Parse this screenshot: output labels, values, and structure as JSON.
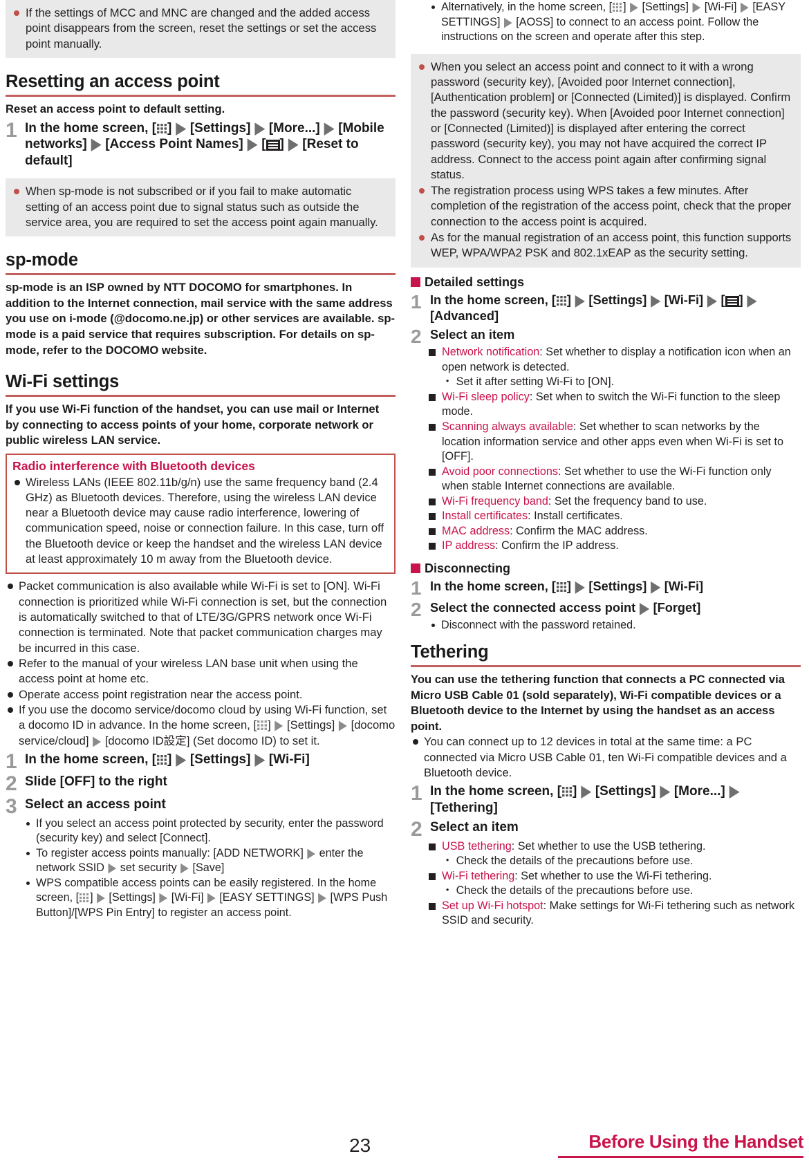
{
  "icons": {
    "app_grid": "app-grid-icon",
    "menu": "menu-icon",
    "arrow": "▶"
  },
  "colors": {
    "rule": "#c2605e",
    "accent": "#c8134b",
    "note_bullet": "#c0504a",
    "step_number": "#9a9a9a"
  },
  "left": {
    "note_top": "If the settings of MCC and MNC are changed and the added access point disappears from the screen, reset the settings or set the access point manually.",
    "sec_reset": "Resetting an access point",
    "reset_lead": "Reset an access point to default setting.",
    "reset_step1_num": "1",
    "reset_step1_a": "In the home screen, [",
    "reset_step1_b": "] ",
    "reset_step1_c": "[Settings] ",
    "reset_step1_d": "[More...] ",
    "reset_step1_e": "[Mobile networks] ",
    "reset_step1_f": "[Access Point Names] ",
    "reset_step1_g": "] ",
    "reset_step1_h": "[Reset to default]",
    "note_spmode": "When sp-mode is not subscribed or if you fail to make automatic setting of an access point due to signal status such as outside the service area, you are required to set the access point again manually.",
    "sec_spmode": "sp-mode",
    "spmode_lead": "sp-mode is an ISP owned by NTT DOCOMO for smartphones. In addition to the Internet connection, mail service with the same address you use on i-mode (@docomo.ne.jp) or other services are available. sp-mode is a paid service that requires subscription. For details on sp-mode, refer to the DOCOMO website.",
    "sec_wifi": "Wi-Fi settings",
    "wifi_lead": "If you use Wi-Fi function of the handset, you can use mail or Internet by connecting to access points of your home, corporate network or public wireless LAN service.",
    "redbox_title": "Radio interference with Bluetooth devices",
    "redbox_body": "Wireless LANs (IEEE 802.11b/g/n) use the same frequency band (2.4 GHz) as Bluetooth devices. Therefore, using the wireless LAN device near a Bluetooth device may cause radio interference, lowering of communication speed, noise or connection failure. In this case, turn off the Bluetooth device or keep the handset and the wireless LAN device at least approximately 10 m away from the Bluetooth device.",
    "bullets": [
      "Packet communication is also available while Wi-Fi is set to [ON]. Wi-Fi connection is prioritized while Wi-Fi connection is set, but the connection is automatically switched to that of LTE/3G/GPRS network once Wi-Fi connection is terminated. Note that packet communication charges may be incurred in this case.",
      "Refer to the manual of your wireless LAN base unit when using the access point at home etc.",
      "Operate access point registration near the access point."
    ],
    "docomo_bullet_1": "If you use the docomo service/docomo cloud by using Wi-Fi function, set a docomo ID in advance. In the home screen, [",
    "docomo_bullet_2": "] ",
    "docomo_bullet_3": "[Settings] ",
    "docomo_bullet_4": "[docomo service/cloud] ",
    "docomo_bullet_5": "[docomo ID設定] (Set docomo ID) to set it.",
    "wifi_step1_num": "1",
    "wifi_step1_a": "In the home screen, [",
    "wifi_step1_b": "] ",
    "wifi_step1_c": "[Settings] ",
    "wifi_step1_d": "[Wi-Fi]",
    "wifi_step2_num": "2",
    "wifi_step2": "Slide [OFF] to the right",
    "wifi_step3_num": "3",
    "wifi_step3": "Select an access point",
    "sub1": "If you select an access point protected by security, enter the password (security key) and select [Connect].",
    "sub2_a": "To register access points manually: [ADD NETWORK] ",
    "sub2_b": "enter the network SSID ",
    "sub2_c": "set security ",
    "sub2_d": "[Save]",
    "sub3_a": "WPS compatible access points can be easily registered. In the home screen, [",
    "sub3_b": "] ",
    "sub3_c": "[Settings] ",
    "sub3_d": "[Wi-Fi] ",
    "sub3_e": "[EASY SETTINGS] ",
    "sub3_f": "[WPS Push Button]/[WPS Pin Entry] to register an access point."
  },
  "right": {
    "sub_alt_a": "Alternatively, in the home screen, [",
    "sub_alt_b": "] ",
    "sub_alt_c": "[Settings] ",
    "sub_alt_d": "[Wi-Fi] ",
    "sub_alt_e": "[EASY SETTINGS] ",
    "sub_alt_f": "[AOSS] to connect to an access point. Follow the instructions on the screen and operate after this step.",
    "notes": [
      "When you select an access point and connect to it with a wrong password (security key), [Avoided poor Internet connection], [Authentication problem] or [Connected (Limited)] is displayed. Confirm the password (security key). When [Avoided poor Internet connection] or [Connected (Limited)] is displayed after entering the correct password (security key), you may not have acquired the correct IP address. Connect to the access point again after confirming signal status.",
      "The registration process using WPS takes a few minutes. After completion of the registration of the access point, check that the proper connection to the access point is acquired.",
      "As for the manual registration of an access point, this function supports WEP, WPA/WPA2 PSK and 802.1xEAP as the security setting."
    ],
    "detailed_head": "Detailed settings",
    "det_step1_num": "1",
    "det_step1_a": "In the home screen, [",
    "det_step1_b": "] ",
    "det_step1_c": "[Settings] ",
    "det_step1_d": "[Wi-Fi] ",
    "det_step1_e": "] ",
    "det_step1_f": "[Advanced]",
    "det_step2_num": "2",
    "det_step2": "Select an item",
    "det_items": [
      {
        "term": "Network notification",
        "desc": ": Set whether to display a notification icon when an open network is detected.",
        "mid": "・ Set it after setting Wi-Fi to [ON]."
      },
      {
        "term": "Wi-Fi sleep policy",
        "desc": ": Set when to switch the Wi-Fi function to the sleep mode.",
        "mid": ""
      },
      {
        "term": "Scanning always available",
        "desc": ": Set whether to scan networks by the location information service and other apps even when Wi-Fi is set to [OFF].",
        "mid": ""
      },
      {
        "term": "Avoid poor connections",
        "desc": ": Set whether to use the Wi-Fi function only when stable Internet connections are available.",
        "mid": ""
      },
      {
        "term": "Wi-Fi frequency band",
        "desc": ": Set the frequency band to use.",
        "mid": ""
      },
      {
        "term": "Install certificates",
        "desc": ": Install certificates.",
        "mid": ""
      },
      {
        "term": "MAC address",
        "desc": ": Confirm the MAC address.",
        "mid": ""
      },
      {
        "term": "IP address",
        "desc": ": Confirm the IP address.",
        "mid": ""
      }
    ],
    "disconnect_head": "Disconnecting",
    "dis_step1_num": "1",
    "dis_step1_a": "In the home screen, [",
    "dis_step1_b": "] ",
    "dis_step1_c": "[Settings] ",
    "dis_step1_d": "[Wi-Fi]",
    "dis_step2_num": "2",
    "dis_step2_a": "Select the connected access point ",
    "dis_step2_b": "[Forget]",
    "dis_sub": "Disconnect with the password retained.",
    "sec_tethering": "Tethering",
    "teth_lead": "You can use the tethering function that connects a PC connected via Micro USB Cable 01 (sold separately), Wi-Fi compatible devices or a Bluetooth device to the Internet by using the handset as an access point.",
    "teth_bullet": "You can connect up to 12 devices in total at the same time: a PC connected via Micro USB Cable 01, ten Wi-Fi compatible devices and a Bluetooth device.",
    "teth_step1_num": "1",
    "teth_step1_a": "In the home screen, [",
    "teth_step1_b": "] ",
    "teth_step1_c": "[Settings] ",
    "teth_step1_d": "[More...] ",
    "teth_step1_e": "[Tethering]",
    "teth_step2_num": "2",
    "teth_step2": "Select an item",
    "teth_items": [
      {
        "term": "USB tethering",
        "desc": ": Set whether to use the USB tethering.",
        "mid": "・ Check the details of the precautions before use."
      },
      {
        "term": "Wi-Fi tethering",
        "desc": ": Set whether to use the Wi-Fi tethering.",
        "mid": "・ Check the details of the precautions before use."
      },
      {
        "term": "Set up Wi-Fi hotspot",
        "desc": ": Make settings for Wi-Fi tethering such as network SSID and security.",
        "mid": ""
      }
    ]
  },
  "footer": {
    "page_number": "23",
    "section_title": "Before Using the Handset"
  }
}
